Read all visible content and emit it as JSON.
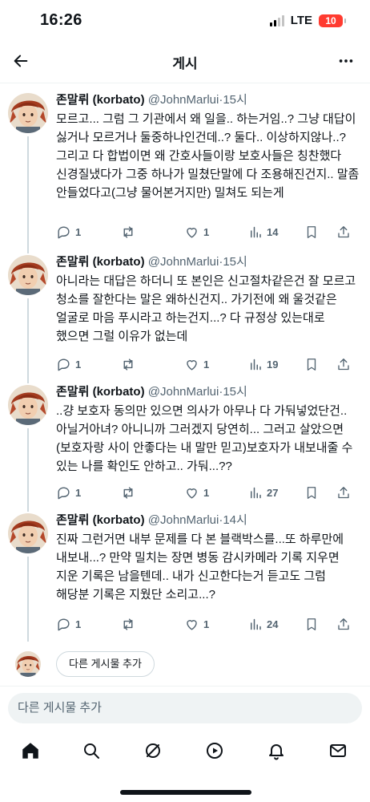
{
  "status_bar": {
    "time": "16:26",
    "network": "LTE",
    "battery": "10",
    "battery_color": "#ff3b30"
  },
  "header": {
    "title": "게시",
    "back_icon": "arrow-left-icon",
    "more_icon": "more-horizontal-icon"
  },
  "colors": {
    "text": "#0f1419",
    "secondary": "#536471",
    "border": "#cfd9de",
    "background": "#ffffff",
    "input_bg": "#eff3f4"
  },
  "posts": [
    {
      "author": "존말뤼 (korbato)",
      "handle": "@JohnMarlui",
      "time": "·15시",
      "text": "모르고... 그럼 그 기관에서 왜 일을.. 하는거임..? 그냥 대답이 싫거나 모르거나 둘중하나인건데..? 둘다.. 이상하지않나..? 그리고 다 합법이면 왜 간호사들이랑 보호사들은 칭찬했다 신경질냈다가 그중 하나가 밀쳤단말에 다 조용해진건지.. 말좀 안들었다고(그냥 물어본거지만) 밀쳐도 되는게",
      "replies": "1",
      "reposts": "",
      "likes": "1",
      "views": "14"
    },
    {
      "author": "존말뤼 (korbato)",
      "handle": "@JohnMarlui",
      "time": "·15시",
      "text": "아니라는 대답은 하더니 또 본인은 신고절차같은건 잘 모르고 청소를 잘한다는 말은 왜하신건지.. 가기전에 왜 울것같은 얼굴로 마음 푸시라고 하는건지...? 다 규정상 있는대로 했으면 그럴 이유가 없는데",
      "replies": "1",
      "reposts": "",
      "likes": "1",
      "views": "19"
    },
    {
      "author": "존말뤼 (korbato)",
      "handle": "@JohnMarlui",
      "time": "·15시",
      "text": "..걍 보호자 동의만 있으면 의사가 아무나 다 가둬넣었단건.. 아닐거아녀? 아니니까 그러겠지 당연히... 그러고 살았으면 (보호자랑 사이 안좋다는 내 말만 믿고)보호자가 내보내줄 수 있는 나를 확인도 안하고.. 가둬...??",
      "replies": "1",
      "reposts": "",
      "likes": "1",
      "views": "27"
    },
    {
      "author": "존말뤼 (korbato)",
      "handle": "@JohnMarlui",
      "time": "·14시",
      "text": "진짜 그런거면 내부 문제를 다 본 블랙박스를...또 하루만에 내보내...? 만약 밀치는 장면 병동 감시카메라 기록 지우면 지운 기록은 남을텐데.. 내가 신고한다는거 듣고도 그럼 해당분 기록은 지웠단 소리고...?",
      "replies": "1",
      "reposts": "",
      "likes": "1",
      "views": "24"
    }
  ],
  "add_post": {
    "button_label": "다른 게시물 추가"
  },
  "compose": {
    "placeholder": "다른 게시물 추가"
  },
  "tabbar": {
    "items": [
      "home-icon",
      "search-icon",
      "grok-icon",
      "video-icon",
      "notifications-icon",
      "messages-icon"
    ]
  }
}
